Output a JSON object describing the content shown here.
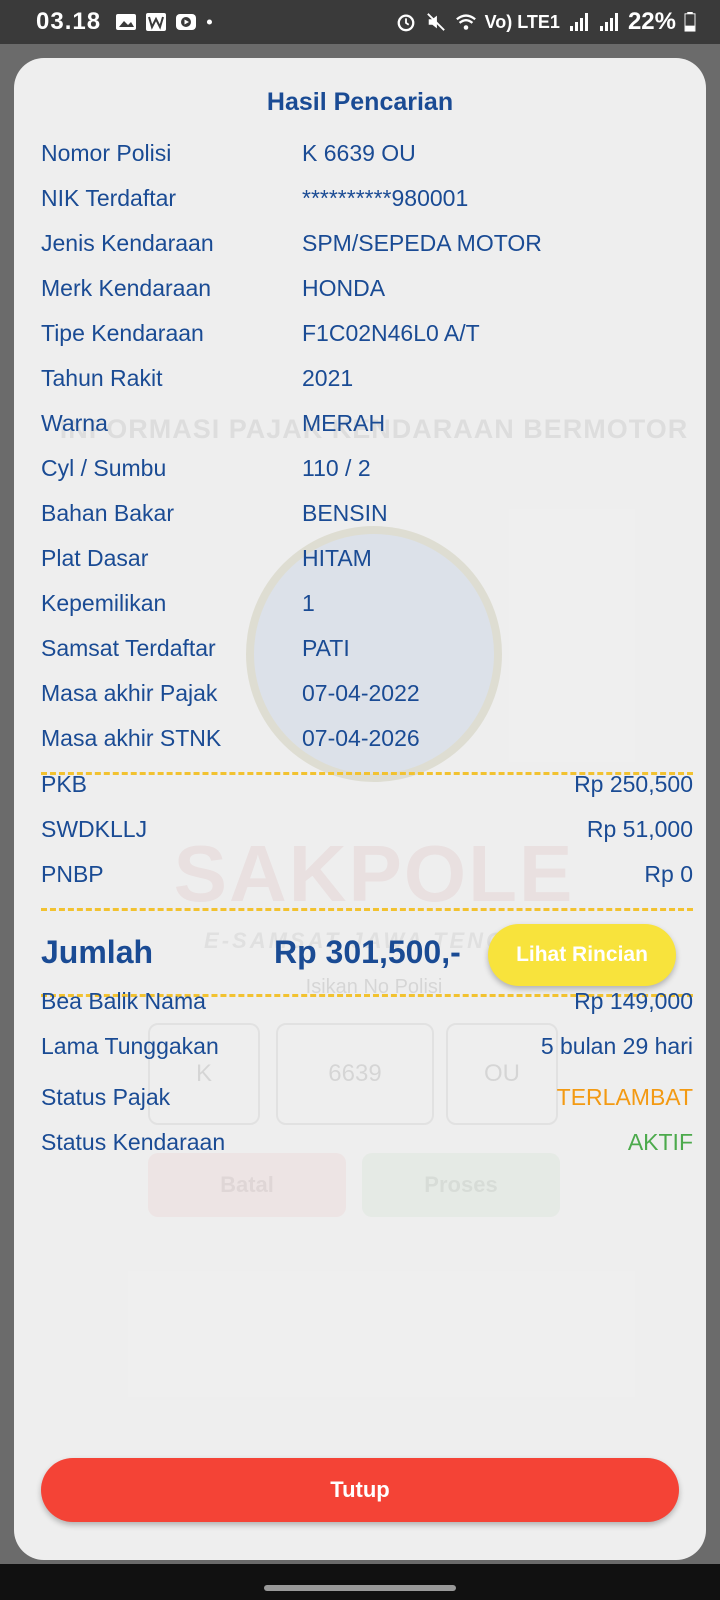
{
  "status_bar": {
    "time": "03.18",
    "network_label": "Vo) LTE1",
    "battery_percent": "22%",
    "icons": [
      "gallery-icon",
      "word-icon",
      "video-icon",
      "dot-icon",
      "alarm-icon",
      "mute-icon",
      "wifi-icon",
      "signal-icon",
      "signal-icon",
      "battery-icon"
    ]
  },
  "background_app": {
    "title": "INFORMASI PAJAK KENDARAAN BERMOTOR",
    "brand": "SAKPOLE",
    "subtitle": "E-SAMSAT JAWA TENGAH",
    "input_hint": "Isikan No Polisi",
    "plate_fields": [
      "K",
      "6639",
      "OU"
    ],
    "cancel_label": "Batal",
    "process_label": "Proses"
  },
  "dialog": {
    "title": "Hasil Pencarian",
    "details": [
      {
        "label": "Nomor Polisi",
        "value": "K 6639 OU"
      },
      {
        "label": "NIK Terdaftar",
        "value": "**********980001"
      },
      {
        "label": "Jenis Kendaraan",
        "value": "SPM/SEPEDA MOTOR"
      },
      {
        "label": "Merk Kendaraan",
        "value": "HONDA"
      },
      {
        "label": "Tipe Kendaraan",
        "value": "F1C02N46L0 A/T"
      },
      {
        "label": "Tahun Rakit",
        "value": "2021"
      },
      {
        "label": "Warna",
        "value": "MERAH"
      },
      {
        "label": "Cyl / Sumbu",
        "value": "110 / 2"
      },
      {
        "label": "Bahan Bakar",
        "value": "BENSIN"
      },
      {
        "label": "Plat Dasar",
        "value": "HITAM"
      },
      {
        "label": "Kepemilikan",
        "value": "1"
      },
      {
        "label": "Samsat Terdaftar",
        "value": "PATI"
      },
      {
        "label": "Masa akhir Pajak",
        "value": "07-04-2022"
      },
      {
        "label": "Masa akhir STNK",
        "value": "07-04-2026"
      }
    ],
    "fees": [
      {
        "label": "PKB",
        "value": "Rp 250,500"
      },
      {
        "label": "SWDKLLJ",
        "value": "Rp 51,000"
      },
      {
        "label": "PNBP",
        "value": "Rp 0"
      }
    ],
    "total": {
      "label": "Jumlah",
      "value": "Rp 301,500,-",
      "button_label": "Lihat Rincian"
    },
    "extra": [
      {
        "label": "Bea Balik Nama",
        "value": "Rp 149,000"
      },
      {
        "label": "Lama Tunggakan",
        "value": "5 bulan 29 hari"
      }
    ],
    "status": [
      {
        "label": "Status Pajak",
        "value": "TERLAMBAT",
        "color": "#f39a13"
      },
      {
        "label": "Status Kendaraan",
        "value": "AKTIF",
        "color": "#4caa4c"
      }
    ],
    "close_label": "Tutup"
  },
  "colors": {
    "primary_text": "#1a4b94",
    "accent_yellow": "#f8e33c",
    "dash_yellow": "#f2c230",
    "close_red": "#f44336"
  }
}
